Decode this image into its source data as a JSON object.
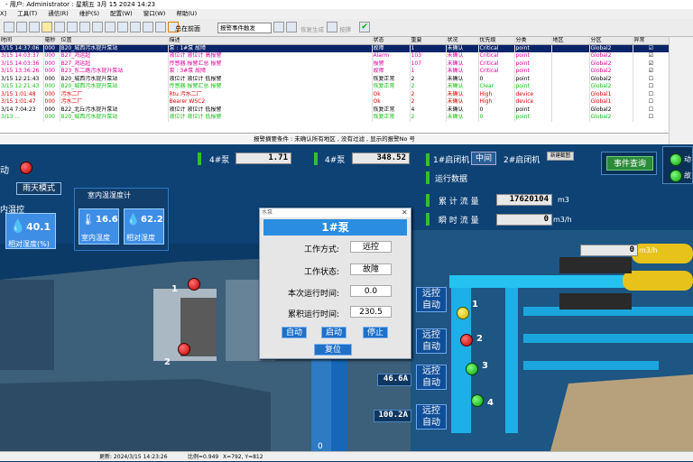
{
  "title": "- 用户: Administrator : 星期五 3月 15 2024 14:23",
  "menu": [
    "X]",
    "工具(T)",
    "通信(R)",
    "维护(S)",
    "配置(W)",
    "窗口(W)",
    "帮助(U)"
  ],
  "toolbar": {
    "front_label": "总在前面",
    "filter_select": "报警事件触发",
    "confirm_label": "恢复生成",
    "play_label": "按擇"
  },
  "alarm_table": {
    "headers": [
      "时间",
      "毫秒",
      "位置",
      "描述",
      "状态",
      "重要",
      "状况",
      "优先级",
      "分类",
      "地区",
      "分区",
      "异常"
    ],
    "rows": [
      {
        "time": "3/15 14:37:06",
        "ms": "000",
        "loc": "B20_城西污水提升泵站",
        "desc": "泵 : 1#泵  故障",
        "state": "故障",
        "imp": "1",
        "cond": "未确认",
        "pri": "Critical",
        "cat": "point",
        "area": "",
        "zone": "Global2",
        "chk": "☑",
        "color": "#000000",
        "sel": true
      },
      {
        "time": "3/15 14:03:37",
        "ms": "000",
        "loc": "B27_鸿运超",
        "desc": "液位计  液位计  高报警",
        "state": "Alarm",
        "imp": "103",
        "cond": "未确认",
        "pri": "Critical",
        "cat": "point",
        "area": "",
        "zone": "Global2",
        "chk": "☑",
        "color": "#e0009a",
        "sel": false
      },
      {
        "time": "3/15 14:03:36",
        "ms": "000",
        "loc": "B27_鸿运超",
        "desc": "传感器  报警汇总  报警",
        "state": "报警",
        "imp": "107",
        "cond": "未确认",
        "pri": "Critical",
        "cat": "point",
        "area": "",
        "zone": "Global2",
        "chk": "☑",
        "color": "#e0009a",
        "sel": false
      },
      {
        "time": "3/15 13:36:26",
        "ms": "000",
        "loc": "B23_东二路污水提升泵站",
        "desc": "泵 : 3#泵  故障",
        "state": "故障",
        "imp": "1",
        "cond": "未确认",
        "pri": "Critical",
        "cat": "point",
        "area": "",
        "zone": "Global2",
        "chk": "☑",
        "color": "#e0009a",
        "sel": false
      },
      {
        "time": "3/15 12:21:43",
        "ms": "000",
        "loc": "B20_城西污水提升泵站",
        "desc": "液位计  液位计  低报警",
        "state": "恢复正常",
        "imp": "2",
        "cond": "未确认",
        "pri": "0",
        "cat": "point",
        "area": "",
        "zone": "Global2",
        "chk": "☐",
        "color": "#000000",
        "sel": false
      },
      {
        "time": "3/15 12:21:43",
        "ms": "000",
        "loc": "B20_城西污水提升泵站",
        "desc": "传感器  报警汇总  报警",
        "state": "恢复正常",
        "imp": "2",
        "cond": "未确认",
        "pri": "Clear",
        "cat": "point",
        "area": "",
        "zone": "Global2",
        "chk": "☐",
        "color": "#10c010",
        "sel": false
      },
      {
        "time": "3/15 1:01:48",
        "ms": "000",
        "loc": "污水二厂",
        "desc": "Rtu 污水二厂",
        "state": "Ok",
        "imp": "2",
        "cond": "未确认",
        "pri": "High",
        "cat": "device",
        "area": "",
        "zone": "Global1",
        "chk": "☐",
        "color": "#e00000",
        "sel": false
      },
      {
        "time": "3/15 1:01:47",
        "ms": "000",
        "loc": "污水二厂",
        "desc": "Bearer WSC2",
        "state": "Ok",
        "imp": "2",
        "cond": "未确认",
        "pri": "High",
        "cat": "device",
        "area": "",
        "zone": "Global1",
        "chk": "☐",
        "color": "#e00000",
        "sel": false
      },
      {
        "time": "3/14 7:04:23",
        "ms": "000",
        "loc": "B22_北丘污水提升泵站",
        "desc": "液位计  液位计  低报警",
        "state": "恢复正常",
        "imp": "4",
        "cond": "未确认",
        "pri": "0",
        "cat": "point",
        "area": "",
        "zone": "Global2",
        "chk": "☐",
        "color": "#000000",
        "sel": false
      },
      {
        "time": "3/13 ...",
        "ms": "000",
        "loc": "B20_城西污水提升泵站",
        "desc": "液位计  液位计  低报警",
        "state": "恢复正常",
        "imp": "2",
        "cond": "未确认",
        "pri": "0",
        "cat": "point",
        "area": "",
        "zone": "Global2",
        "chk": "☐",
        "color": "#10c010",
        "sel": false
      }
    ],
    "filter_text": "报警摘要条件 : 未确认所有地区 , 没有过滤 , 显示的报警No 号"
  },
  "scada": {
    "pump4_a_label": "4#泵",
    "pump4_a_value": "1.71",
    "pump4_b_label": "4#泵",
    "pump4_b_value": "348.52",
    "machine1_label": "1#启闭机",
    "mid_label": "中间",
    "machine2_label": "2#启闭机",
    "small_badge": "新建截图",
    "running_label": "运行数据",
    "cumulative_label": "累 计 流 量",
    "cumulative_value": "17620104",
    "cumulative_unit": "m3",
    "instant_label": "瞬 时 流 量",
    "instant_value": "0",
    "instant_unit": "m3/h",
    "flow_value": "0",
    "flow_unit": "m3/h",
    "event_query": "事件查询",
    "auto_left": "动",
    "rain_mode": "雨天模式",
    "indoor_label": "内温控",
    "indoor_temp_title": "室内温湿度计",
    "left_tile_value": "40.1",
    "left_tile_label": "相对湿度(%)",
    "tile1_value": "16.6",
    "tile1_label": "室内温度",
    "tile2_value": "62.2",
    "tile2_label": "相对湿度",
    "remote_label": "远控",
    "auto_label": "自动",
    "current1": "46.6A",
    "current2": "100.2A",
    "pump_numbers": [
      "1",
      "2",
      "3",
      "4"
    ],
    "screen_numbers": [
      "1",
      "2"
    ],
    "level_zero": "0",
    "right_edge1": "动",
    "right_edge2": "故"
  },
  "dialog": {
    "window_title": "水泵",
    "heading": "1#泵",
    "work_mode_label": "工作方式:",
    "work_mode_value": "远控",
    "work_state_label": "工作状态:",
    "work_state_value": "故障",
    "run_time_label": "本次运行时间:",
    "run_time_value": "0.0",
    "total_time_label": "累积运行时间:",
    "total_time_value": "230.5",
    "btn_auto": "自动",
    "btn_start": "启动",
    "btn_stop": "停止",
    "btn_reset": "复位"
  },
  "status": {
    "updated": "更新: 2024/3/15 14:23:26",
    "ratio": "比例=0.949",
    "coords": "X=792, Y=812"
  }
}
